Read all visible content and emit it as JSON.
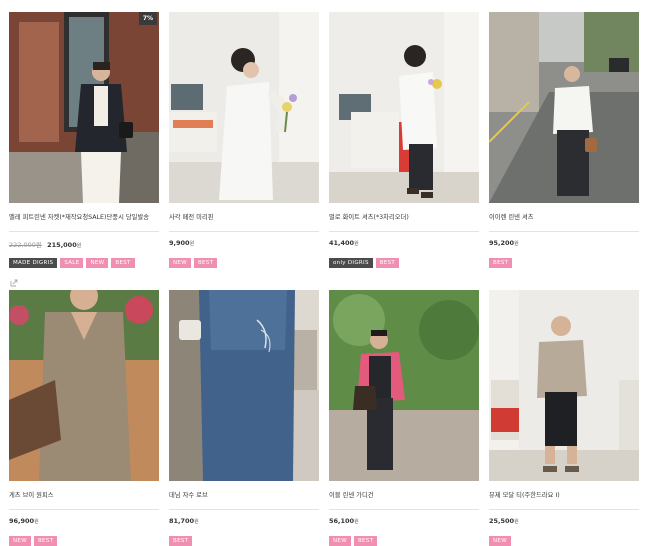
{
  "products": [
    {
      "name": "멜레 피트린넨 자켓(*재작요청SALE)단풍시 당일발송",
      "old_price": "222,000원",
      "price": "215,000",
      "won": "원",
      "corner_badge": "7%",
      "badges": [
        {
          "text": "MADE DIGRIS",
          "style": "dark"
        },
        {
          "text": "SALE",
          "style": "pink"
        },
        {
          "text": "NEW",
          "style": "pink"
        },
        {
          "text": "BEST",
          "style": "pink"
        }
      ],
      "share_icon": "share-icon"
    },
    {
      "name": "사각 페전 미리핀",
      "old_price": "",
      "price": "9,900",
      "won": "원",
      "badges": [
        {
          "text": "NEW",
          "style": "pink"
        },
        {
          "text": "BEST",
          "style": "pink"
        }
      ]
    },
    {
      "name": "멀로 화이트 셔츠(*3차리오더)",
      "old_price": "",
      "price": "41,400",
      "won": "원",
      "badges": [
        {
          "text": "only DIGRIS",
          "style": "dark"
        },
        {
          "text": "BEST",
          "style": "pink"
        }
      ]
    },
    {
      "name": "이이렌 린넨 셔츠",
      "old_price": "",
      "price": "95,200",
      "won": "원",
      "badges": [
        {
          "text": "BEST",
          "style": "pink"
        }
      ]
    },
    {
      "name": "게츠 브이 원피스",
      "old_price": "",
      "price": "96,900",
      "won": "원",
      "badges": [
        {
          "text": "NEW",
          "style": "pink"
        },
        {
          "text": "BEST",
          "style": "pink"
        }
      ]
    },
    {
      "name": "데님 자수 로브",
      "old_price": "",
      "price": "81,700",
      "won": "원",
      "badges": [
        {
          "text": "BEST",
          "style": "pink"
        }
      ]
    },
    {
      "name": "이블 린넨 가디건",
      "old_price": "",
      "price": "56,100",
      "won": "원",
      "badges": [
        {
          "text": "NEW",
          "style": "pink"
        },
        {
          "text": "BEST",
          "style": "pink"
        }
      ]
    },
    {
      "name": "뮤제 모달 티(주한드라요 I)",
      "old_price": "",
      "price": "25,500",
      "won": "원",
      "badges": [
        {
          "text": "NEW",
          "style": "pink"
        }
      ]
    }
  ],
  "colors": {
    "badge_pink": "#f08fb1",
    "badge_dark": "#4b4b4b",
    "divider": "#e3e3e3"
  }
}
